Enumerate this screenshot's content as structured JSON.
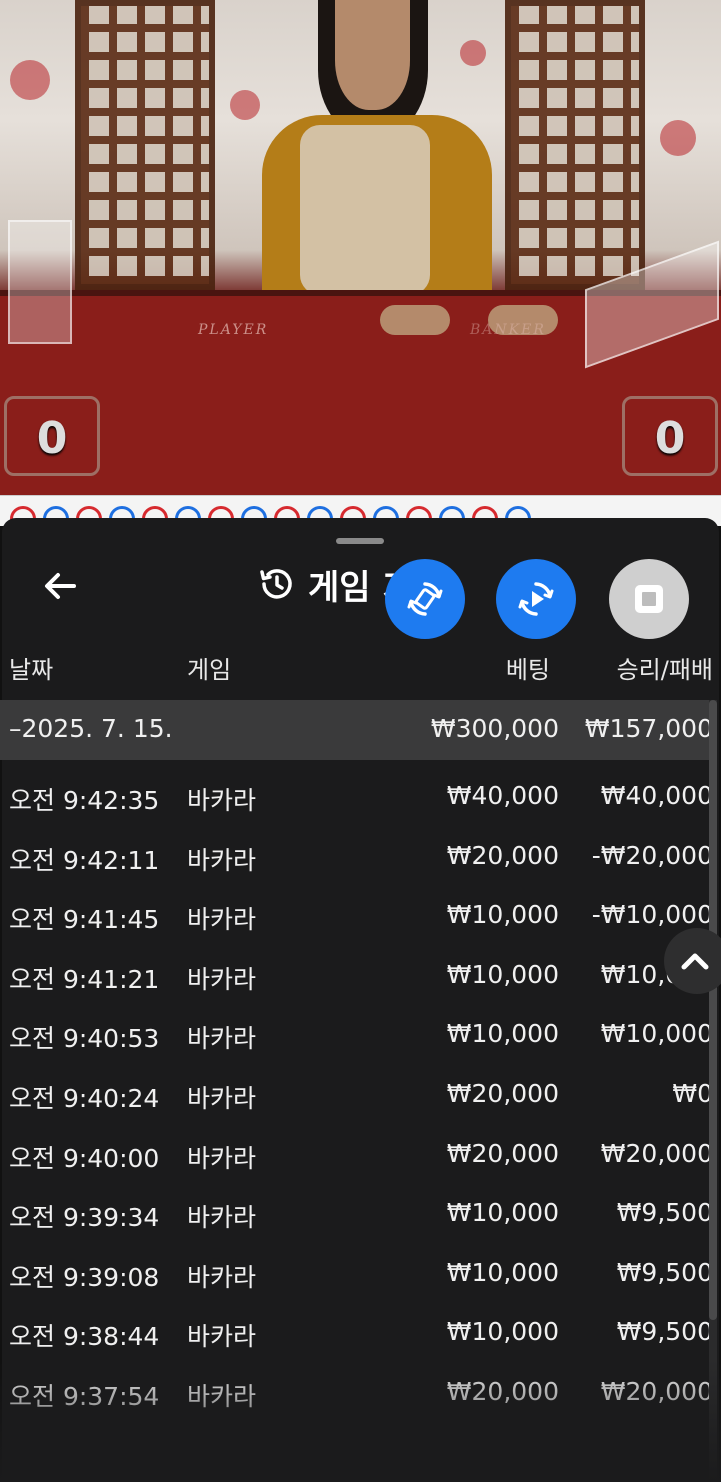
{
  "video": {
    "player_label": "PLAYER",
    "banker_label": "BANKER",
    "player_score": "0",
    "banker_score": "0"
  },
  "roadmap": {
    "circles": [
      "red",
      "blue",
      "red",
      "blue",
      "red",
      "blue",
      "red",
      "blue",
      "red",
      "blue",
      "red",
      "blue",
      "red",
      "blue",
      "red",
      "blue"
    ]
  },
  "header": {
    "title": "게임 기록"
  },
  "columns": {
    "date": "날짜",
    "game": "게임",
    "bet": "베팅",
    "win_loss": "승리/패배"
  },
  "summary": {
    "date": "–2025. 7. 15.",
    "bet": "₩300,000",
    "win_loss": "₩157,000"
  },
  "rows": [
    {
      "time": "오전 9:42:35",
      "game": "바카라",
      "bet": "₩40,000",
      "result": "₩40,000"
    },
    {
      "time": "오전 9:42:11",
      "game": "바카라",
      "bet": "₩20,000",
      "result": "-₩20,000"
    },
    {
      "time": "오전 9:41:45",
      "game": "바카라",
      "bet": "₩10,000",
      "result": "-₩10,000"
    },
    {
      "time": "오전 9:41:21",
      "game": "바카라",
      "bet": "₩10,000",
      "result": "₩10,000"
    },
    {
      "time": "오전 9:40:53",
      "game": "바카라",
      "bet": "₩10,000",
      "result": "₩10,000"
    },
    {
      "time": "오전 9:40:24",
      "game": "바카라",
      "bet": "₩20,000",
      "result": "₩0"
    },
    {
      "time": "오전 9:40:00",
      "game": "바카라",
      "bet": "₩20,000",
      "result": "₩20,000"
    },
    {
      "time": "오전 9:39:34",
      "game": "바카라",
      "bet": "₩10,000",
      "result": "₩9,500"
    },
    {
      "time": "오전 9:39:08",
      "game": "바카라",
      "bet": "₩10,000",
      "result": "₩9,500"
    },
    {
      "time": "오전 9:38:44",
      "game": "바카라",
      "bet": "₩10,000",
      "result": "₩9,500"
    },
    {
      "time": "오전 9:37:54",
      "game": "바카라",
      "bet": "₩20,000",
      "result": "₩20,000"
    }
  ],
  "colors": {
    "accent_blue": "#1e7bf0",
    "sheet_bg": "#1b1b1c",
    "summary_bg": "#3a3a3b"
  }
}
